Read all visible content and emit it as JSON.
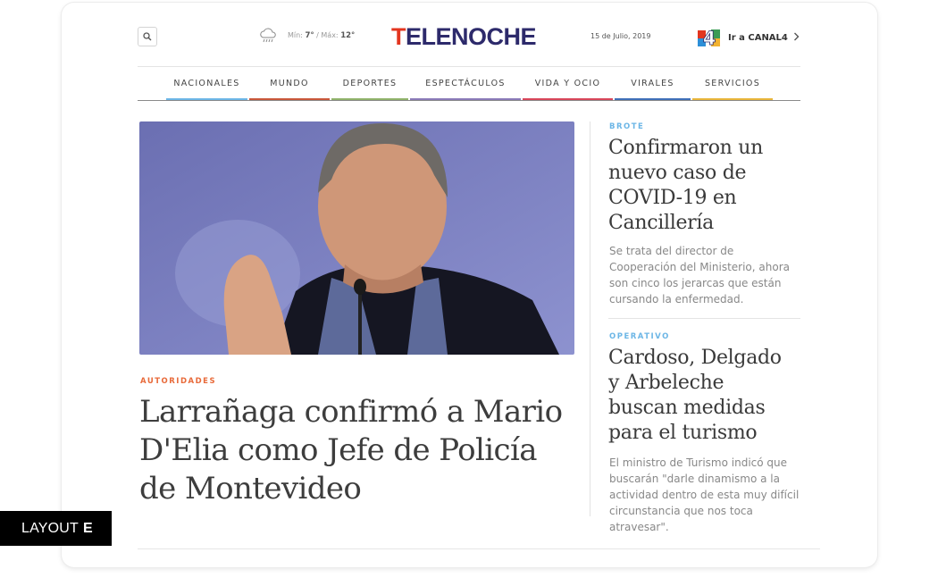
{
  "header": {
    "logo_initial": "T",
    "logo_rest": "ELENOCHE",
    "weather": {
      "icon": "cloud-rain-icon",
      "min_label": "Mín:",
      "min_value": "7°",
      "max_label": "/ Máx:",
      "max_value": "12°"
    },
    "date": "15 de Julio, 2019",
    "canal_badge": "4",
    "canal_label": "Ir a CANAL4"
  },
  "nav": [
    {
      "label": "NACIONALES",
      "color": "#6cb6e6"
    },
    {
      "label": "MUNDO",
      "color": "#c9573a"
    },
    {
      "label": "DEPORTES",
      "color": "#8fb26a"
    },
    {
      "label": "ESPECTÁCULOS",
      "color": "#8a7ab8"
    },
    {
      "label": "VIDA Y OCIO",
      "color": "#d8455a"
    },
    {
      "label": "VIRALES",
      "color": "#3f6fb8"
    },
    {
      "label": "SERVICIOS",
      "color": "#e8b53a"
    }
  ],
  "main_story": {
    "kicker": "AUTORIDADES",
    "headline": "Larrañaga confirmó a Mario D'Elia como  Jefe de Policía de Montevideo"
  },
  "side_stories": [
    {
      "kicker": "BROTE",
      "headline": "Confirmaron un nuevo caso de COVID-19 en Cancillería",
      "summary": "Se trata del director de Cooperación del Ministerio, ahora son cinco los jerarcas que están cursando la enfermedad."
    },
    {
      "kicker": "OPERATIVO",
      "headline": "Cardoso, Delgado y Arbeleche buscan medidas para el turismo",
      "summary": "El ministro de Turismo indicó que buscarán \"darle dinamismo a la actividad dentro de esta muy difícil circunstancia que nos toca atravesar\"."
    }
  ],
  "badge": {
    "prefix": "LAYOUT",
    "letter": "E"
  },
  "colors": {
    "brand": "#2d2a6b",
    "brand_accent": "#e3351f",
    "main_kicker": "#e86a3a",
    "side_kicker": "#6cb6e6"
  }
}
